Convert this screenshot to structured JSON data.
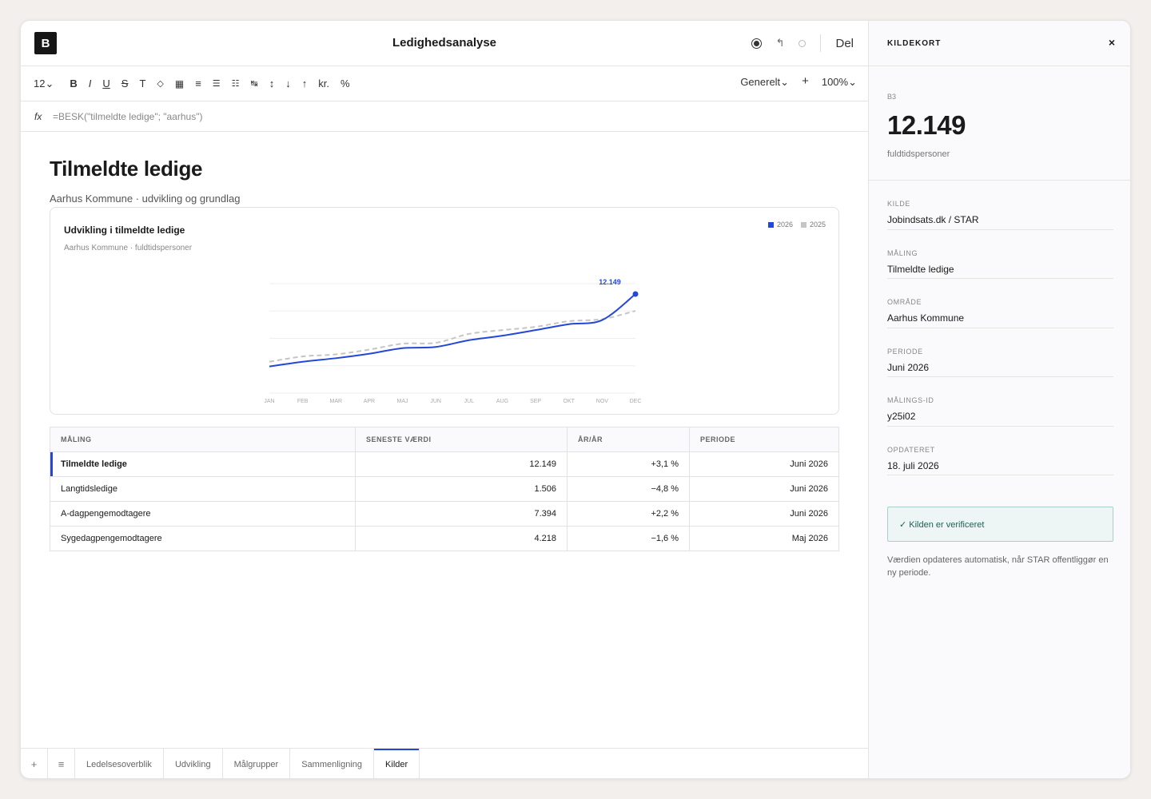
{
  "app": {
    "logo": "B",
    "doc_title": "Ledighedsanalyse",
    "share_label": "Del"
  },
  "toolbar": {
    "font_size": "12⌄",
    "format": "Generelt⌄",
    "plus": "+",
    "zoom": "100%⌄",
    "currency": "kr.",
    "percent": "%"
  },
  "formula": {
    "fx": "fx",
    "expression": "=BESK(\"tilmeldte ledige\"; \"aarhus\")"
  },
  "sheet": {
    "title": "Tilmeldte ledige",
    "subtitle": "Aarhus Kommune · udvikling og grundlag"
  },
  "chart_data": {
    "type": "line",
    "title": "Udvikling i tilmeldte ledige",
    "subtitle": "Aarhus Kommune · fuldtidspersoner",
    "categories": [
      "JAN",
      "FEB",
      "MAR",
      "APR",
      "MAJ",
      "JUN",
      "JUL",
      "AUG",
      "SEP",
      "OKT",
      "NOV",
      "DEC"
    ],
    "series": [
      {
        "name": "2026",
        "color": "#2447d6",
        "values": [
          9700,
          9860,
          9980,
          10130,
          10320,
          10360,
          10590,
          10740,
          10930,
          11130,
          11270,
          12149
        ]
      },
      {
        "name": "2025",
        "color": "#c5c5c5",
        "values": [
          9860,
          10040,
          10110,
          10270,
          10470,
          10500,
          10800,
          10930,
          11040,
          11230,
          11300,
          11580
        ]
      }
    ],
    "annotation": "12.149",
    "ylim": [
      8800,
      12500
    ],
    "grid": true,
    "legend": "top-right"
  },
  "table": {
    "headers": [
      "MÅLING",
      "SENESTE VÆRDI",
      "ÅR/ÅR",
      "PERIODE"
    ],
    "rows": [
      [
        "Tilmeldte ledige",
        "12.149",
        "+3,1 %",
        "Juni 2026"
      ],
      [
        "Langtidsledige",
        "1.506",
        "−4,8 %",
        "Juni 2026"
      ],
      [
        "A-dagpengemodtagere",
        "7.394",
        "+2,2 %",
        "Juni 2026"
      ],
      [
        "Sygedagpengemodtagere",
        "4.218",
        "−1,6 %",
        "Maj 2026"
      ]
    ]
  },
  "tabs": [
    "Ledelsesoverblik",
    "Udvikling",
    "Målgrupper",
    "Sammenligning",
    "Kilder"
  ],
  "side": {
    "title": "KILDEKORT",
    "close": "×",
    "cell_ref": "B3",
    "cell_value": "12.149",
    "cell_unit": "fuldtidspersoner",
    "fields": [
      {
        "k": "KILDE",
        "v": "Jobindsats.dk / STAR"
      },
      {
        "k": "MÅLING",
        "v": "Tilmeldte ledige"
      },
      {
        "k": "OMRÅDE",
        "v": "Aarhus Kommune"
      },
      {
        "k": "PERIODE",
        "v": "Juni 2026"
      },
      {
        "k": "MÅLINGS-ID",
        "v": "y25i02"
      },
      {
        "k": "OPDATERET",
        "v": "18. juli 2026"
      }
    ],
    "verified": "✓ Kilden er verificeret",
    "note": "Værdien opdateres automatisk, når STAR offentliggør en ny periode."
  }
}
